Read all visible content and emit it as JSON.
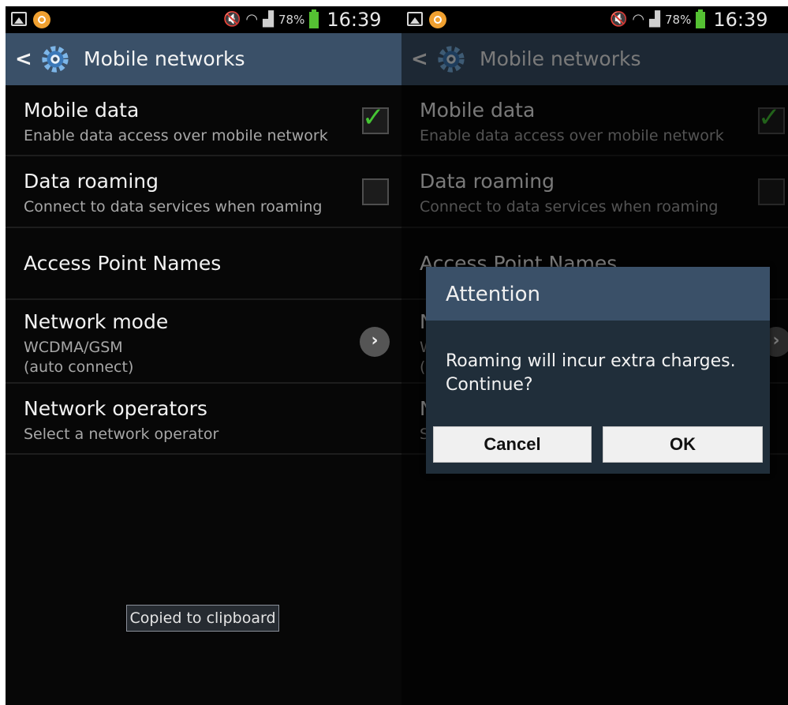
{
  "status_bar": {
    "battery": "78%",
    "time": "16:39"
  },
  "action_bar": {
    "title": "Mobile networks"
  },
  "settings": {
    "mobile_data": {
      "title": "Mobile data",
      "subtitle": "Enable data access over mobile network",
      "checked": true
    },
    "data_roaming": {
      "title": "Data roaming",
      "subtitle": "Connect to data services when roaming",
      "checked": false
    },
    "access_point_names": {
      "title": "Access Point Names"
    },
    "network_mode": {
      "title": "Network mode",
      "value": "WCDMA/GSM",
      "note": "(auto connect)"
    },
    "network_operators": {
      "title": "Network operators",
      "subtitle": "Select a network operator"
    }
  },
  "toast": {
    "text": "Copied to clipboard"
  },
  "dialog": {
    "title": "Attention",
    "message": "Roaming will incur extra charges. Continue?",
    "cancel_label": "Cancel",
    "ok_label": "OK"
  },
  "colors": {
    "action_bar": "#3a5068",
    "check_green": "#45c534",
    "battery_green": "#55c133",
    "dialog_body": "#202e3a"
  }
}
